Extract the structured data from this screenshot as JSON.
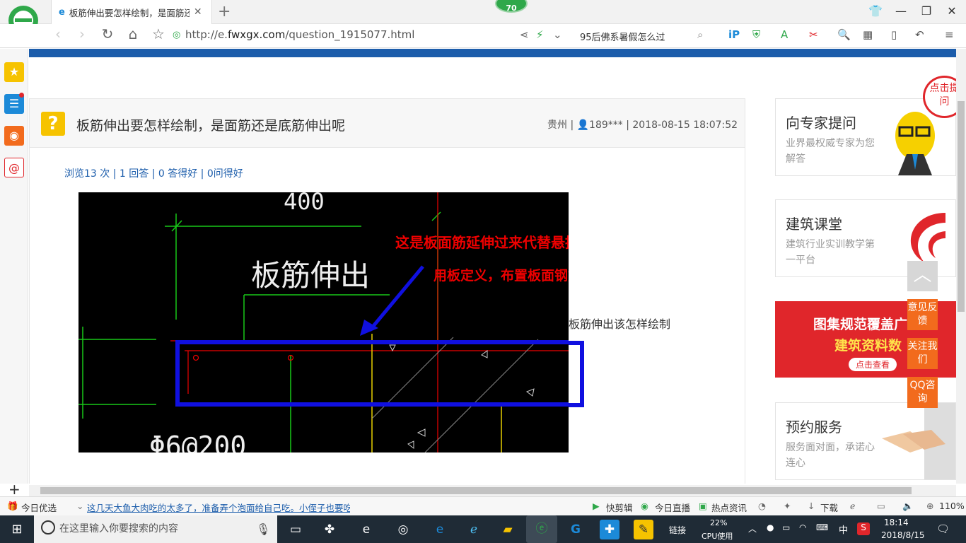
{
  "browser": {
    "tab_title": "板筋伸出要怎样绘制，是面筋还是",
    "badge_count": "70",
    "url_prefix": "http://e.",
    "url_domain": "fwxgx.com",
    "url_path": "/question_1915077.html",
    "search_text": "95后佛系暑假怎么过"
  },
  "question": {
    "title": "板筋伸出要怎样绘制，是面筋还是底筋伸出呢",
    "meta": "贵州 | 👤189*** | 2018-08-15 18:07:52",
    "stats": "浏览13 次 | 1 回答 | 0 答得好 | 0问得好",
    "side_text": "板筋伸出该怎样绘制"
  },
  "cad_image": {
    "dim_text": "400",
    "label": "板筋伸出",
    "note1": "这是板面筋延伸过来代替悬挑板",
    "note2": "用板定义，布置板面钢筋",
    "bottom_text": "Φ6@200"
  },
  "right_cards": [
    {
      "title": "向专家提问",
      "sub": "业界最权威专家为您解答"
    },
    {
      "title": "建筑课堂",
      "sub": "建筑行业实训教学第一平台"
    },
    {
      "title": "预约服务",
      "sub": "服务面对面，承诺心连心"
    }
  ],
  "promo": {
    "line1": "图集规范覆盖广",
    "line2": "建筑资料数",
    "btn": "点击查看"
  },
  "float_badge": "点击提问",
  "float_buttons": [
    "意见反馈",
    "关注我们",
    "QQ咨询"
  ],
  "statusbar": {
    "left_label": "今日优选",
    "news": "这几天大鱼大肉吃的太多了，准备弄个泡面给自己吃。小侄子也要吃...",
    "items": [
      "快剪辑",
      "今日直播",
      "热点资讯",
      "下载"
    ],
    "zoom": "110%"
  },
  "taskbar": {
    "search_placeholder": "在这里输入你要搜索的内容",
    "link_label": "链接",
    "cpu_percent": "22%",
    "cpu_label": "CPU使用",
    "ime": "中",
    "time": "18:14",
    "date": "2018/8/15"
  },
  "colors": {
    "brand_blue": "#1c5dab",
    "accent_orange": "#f26b1d",
    "promo_red": "#e0262b"
  }
}
